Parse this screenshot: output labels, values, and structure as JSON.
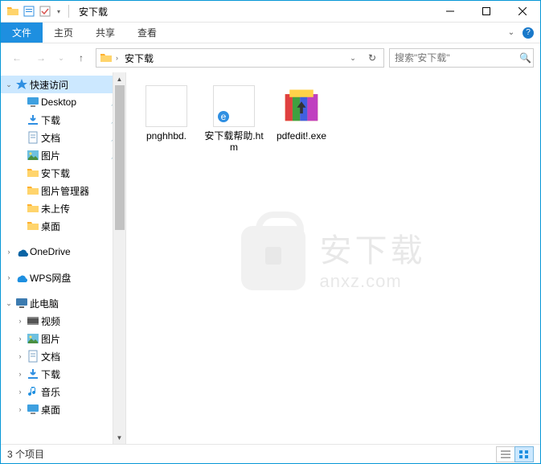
{
  "title": "安下载",
  "ribbon": {
    "file": "文件",
    "home": "主页",
    "share": "共享",
    "view": "查看"
  },
  "address": {
    "location": "安下载",
    "search_placeholder": "搜索\"安下载\""
  },
  "sidebar": {
    "quick": "快速访问",
    "items": [
      {
        "label": "Desktop",
        "pin": true
      },
      {
        "label": "下载",
        "pin": true
      },
      {
        "label": "文档",
        "pin": true
      },
      {
        "label": "图片",
        "pin": true
      },
      {
        "label": "安下载",
        "pin": false
      },
      {
        "label": "图片管理器",
        "pin": false
      },
      {
        "label": "未上传",
        "pin": false
      },
      {
        "label": "桌面",
        "pin": false
      }
    ],
    "onedrive": "OneDrive",
    "wps": "WPS网盘",
    "thispc": "此电脑",
    "pc_items": [
      {
        "label": "视频"
      },
      {
        "label": "图片"
      },
      {
        "label": "文档"
      },
      {
        "label": "下载"
      },
      {
        "label": "音乐"
      },
      {
        "label": "桌面"
      }
    ]
  },
  "files": [
    {
      "name": "pnghhbd."
    },
    {
      "name": "安下载帮助.htm"
    },
    {
      "name": "pdfedit!.exe"
    }
  ],
  "watermark": {
    "cn": "安下载",
    "en": "anxz.com"
  },
  "status": "3 个项目"
}
